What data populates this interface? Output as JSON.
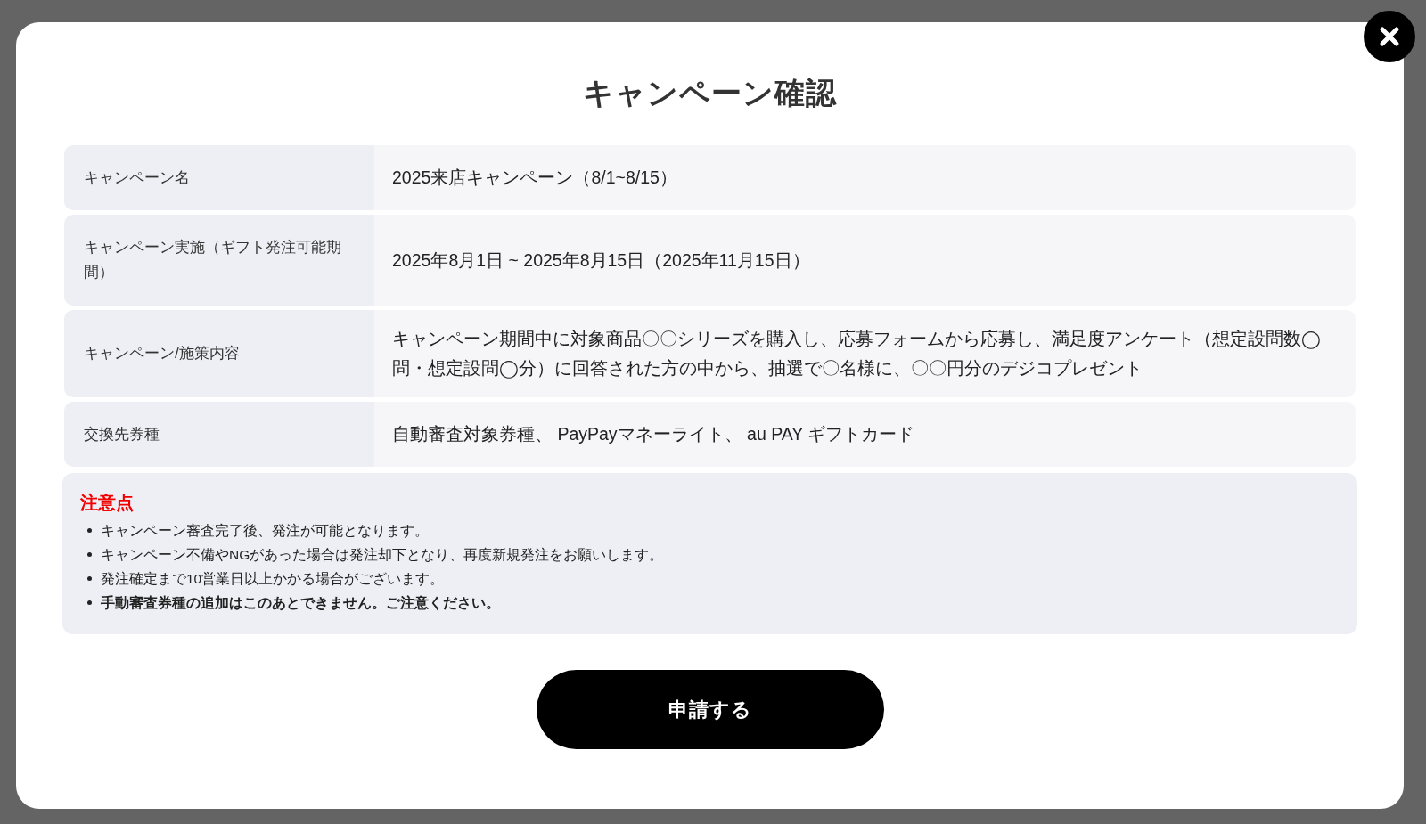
{
  "dialog": {
    "title": "キャンペーン確認"
  },
  "details": [
    {
      "label": "キャンペーン名",
      "value": "2025来店キャンペーン（8/1~8/15）"
    },
    {
      "label": "キャンペーン実施（ギフト発注可能期間）",
      "value": "2025年8月1日 ~ 2025年8月15日（2025年11月15日）"
    },
    {
      "label": "キャンペーン/施策内容",
      "value": "キャンペーン期間中に対象商品〇〇シリーズを購入し、応募フォームから応募し、満足度アンケート（想定設問数◯問・想定設問◯分）に回答された方の中から、抽選で〇名様に、〇〇円分のデジコプレゼント"
    },
    {
      "label": "交換先券種",
      "value": "自動審査対象券種、 PayPayマネーライト、 au PAY ギフトカード"
    }
  ],
  "notice": {
    "title": "注意点",
    "items": [
      {
        "text": "キャンペーン審査完了後、発注が可能となります。",
        "bold": false
      },
      {
        "text": "キャンペーン不備やNGがあった場合は発注却下となり、再度新規発注をお願いします。",
        "bold": false
      },
      {
        "text": "発注確定まで10営業日以上かかる場合がございます。",
        "bold": false
      },
      {
        "text": "手動審査券種の追加はこのあとできません。ご注意ください。",
        "bold": true
      }
    ]
  },
  "submit_button": "申請する"
}
